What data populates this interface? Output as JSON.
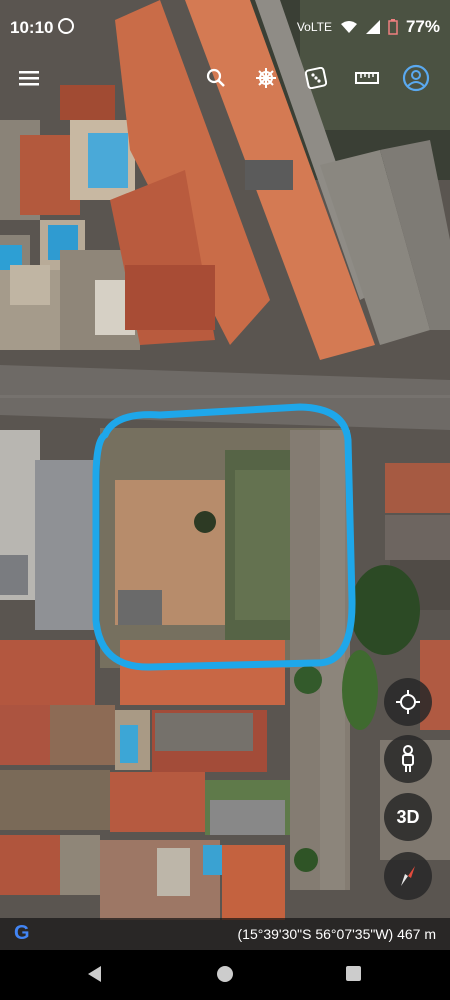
{
  "status": {
    "time": "10:10",
    "network": "VoLTE",
    "battery": "77%"
  },
  "toolbar": {
    "menu_icon": "menu-icon",
    "search_icon": "search-icon",
    "voyager_icon": "ship-wheel-icon",
    "random_icon": "dice-icon",
    "measure_icon": "ruler-icon",
    "account_icon": "account-icon"
  },
  "controls": {
    "my_location_icon": "crosshair-icon",
    "pegman_icon": "pegman-icon",
    "three_d_label": "3D",
    "compass_icon": "compass-icon"
  },
  "footer": {
    "logo_letter": "G",
    "coordinates": "(15°39'30\"S 56°07'35\"W) 467 m"
  },
  "colors": {
    "highlight": "#1ea7ea",
    "fab_bg": "#282828"
  }
}
